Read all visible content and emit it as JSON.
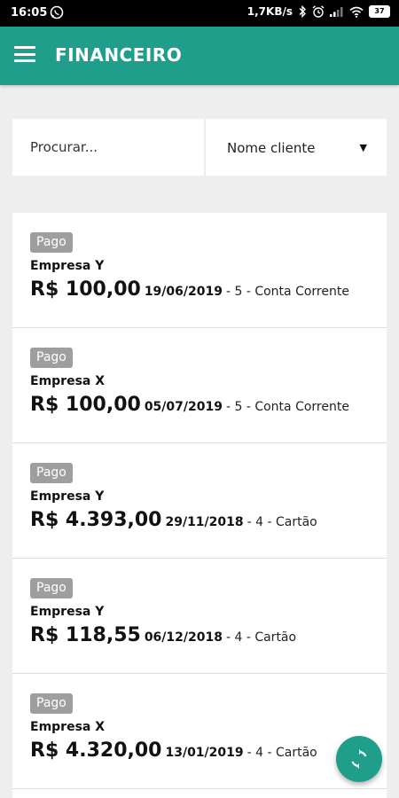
{
  "status_bar": {
    "time": "16:05",
    "speed": "1,7KB/s",
    "battery": "37"
  },
  "app_bar": {
    "title": "FINANCEIRO"
  },
  "filters": {
    "search_placeholder": "Procurar...",
    "select_value": "Nome cliente",
    "select_arrow": "▼"
  },
  "items": [
    {
      "status": "Pago",
      "company": "Empresa Y",
      "amount": "R$ 100,00",
      "date": "19/06/2019",
      "rest": "- 5 - Conta Corrente"
    },
    {
      "status": "Pago",
      "company": "Empresa X",
      "amount": "R$ 100,00",
      "date": "05/07/2019",
      "rest": "- 5 - Conta Corrente"
    },
    {
      "status": "Pago",
      "company": "Empresa Y",
      "amount": "R$ 4.393,00",
      "date": "29/11/2018",
      "rest": "- 4 - Cartão"
    },
    {
      "status": "Pago",
      "company": "Empresa Y",
      "amount": "R$ 118,55",
      "date": "06/12/2018",
      "rest": "- 4 - Cartão"
    },
    {
      "status": "Pago",
      "company": "Empresa X",
      "amount": "R$ 4.320,00",
      "date": "13/01/2019",
      "rest": "- 4 - Cartão"
    }
  ],
  "colors": {
    "primary": "#1f9e8c",
    "badge": "#9e9e9e",
    "background": "#eeeeee"
  },
  "icons": {
    "menu": "hamburger-menu-icon",
    "fab": "sync-icon"
  }
}
